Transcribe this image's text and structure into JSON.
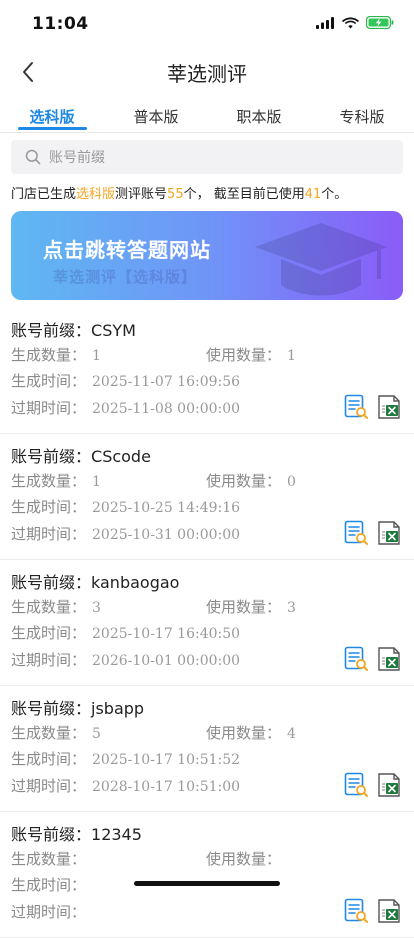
{
  "status": {
    "time": "11:04"
  },
  "nav": {
    "title": "莘选测评"
  },
  "tabs": [
    {
      "label": "选科版"
    },
    {
      "label": "普本版"
    },
    {
      "label": "职本版"
    },
    {
      "label": "专科版"
    }
  ],
  "search": {
    "placeholder": "账号前缀"
  },
  "info": {
    "p1": "门店已生成",
    "edition": "选科版",
    "p2": "测评账号",
    "generated": "55",
    "p3": "个， 截至目前已使用",
    "used": "41",
    "p4": "个。"
  },
  "banner": {
    "title": "点击跳转答题网站",
    "subtitle": "莘选测评【选科版】"
  },
  "labels": {
    "prefix": "账号前缀：",
    "gen_count": "生成数量：",
    "use_count": "使用数量：",
    "gen_time": "生成时间：",
    "expire_time": "过期时间："
  },
  "accounts": [
    {
      "prefix": "CSYM",
      "generated": "1",
      "used": "1",
      "created": "2025-11-07 16:09:56",
      "expires": "2025-11-08 00:00:00"
    },
    {
      "prefix": "CScode",
      "generated": "1",
      "used": "0",
      "created": "2025-10-25 14:49:16",
      "expires": "2025-10-31 00:00:00"
    },
    {
      "prefix": "kanbaogao",
      "generated": "3",
      "used": "3",
      "created": "2025-10-17 16:40:50",
      "expires": "2026-10-01 00:00:00"
    },
    {
      "prefix": "jsbapp",
      "generated": "5",
      "used": "4",
      "created": "2025-10-17 10:51:52",
      "expires": "2028-10-17 10:51:00"
    },
    {
      "prefix": "12345",
      "generated": "",
      "used": "",
      "created": "",
      "expires": ""
    }
  ],
  "colors": {
    "accent": "#1e88e5",
    "highlight": "#f5a623",
    "excel_green": "#1e7a3c",
    "report_blue": "#1e88e5"
  },
  "icons": {
    "report": "report-search-icon",
    "excel": "excel-export-icon"
  }
}
